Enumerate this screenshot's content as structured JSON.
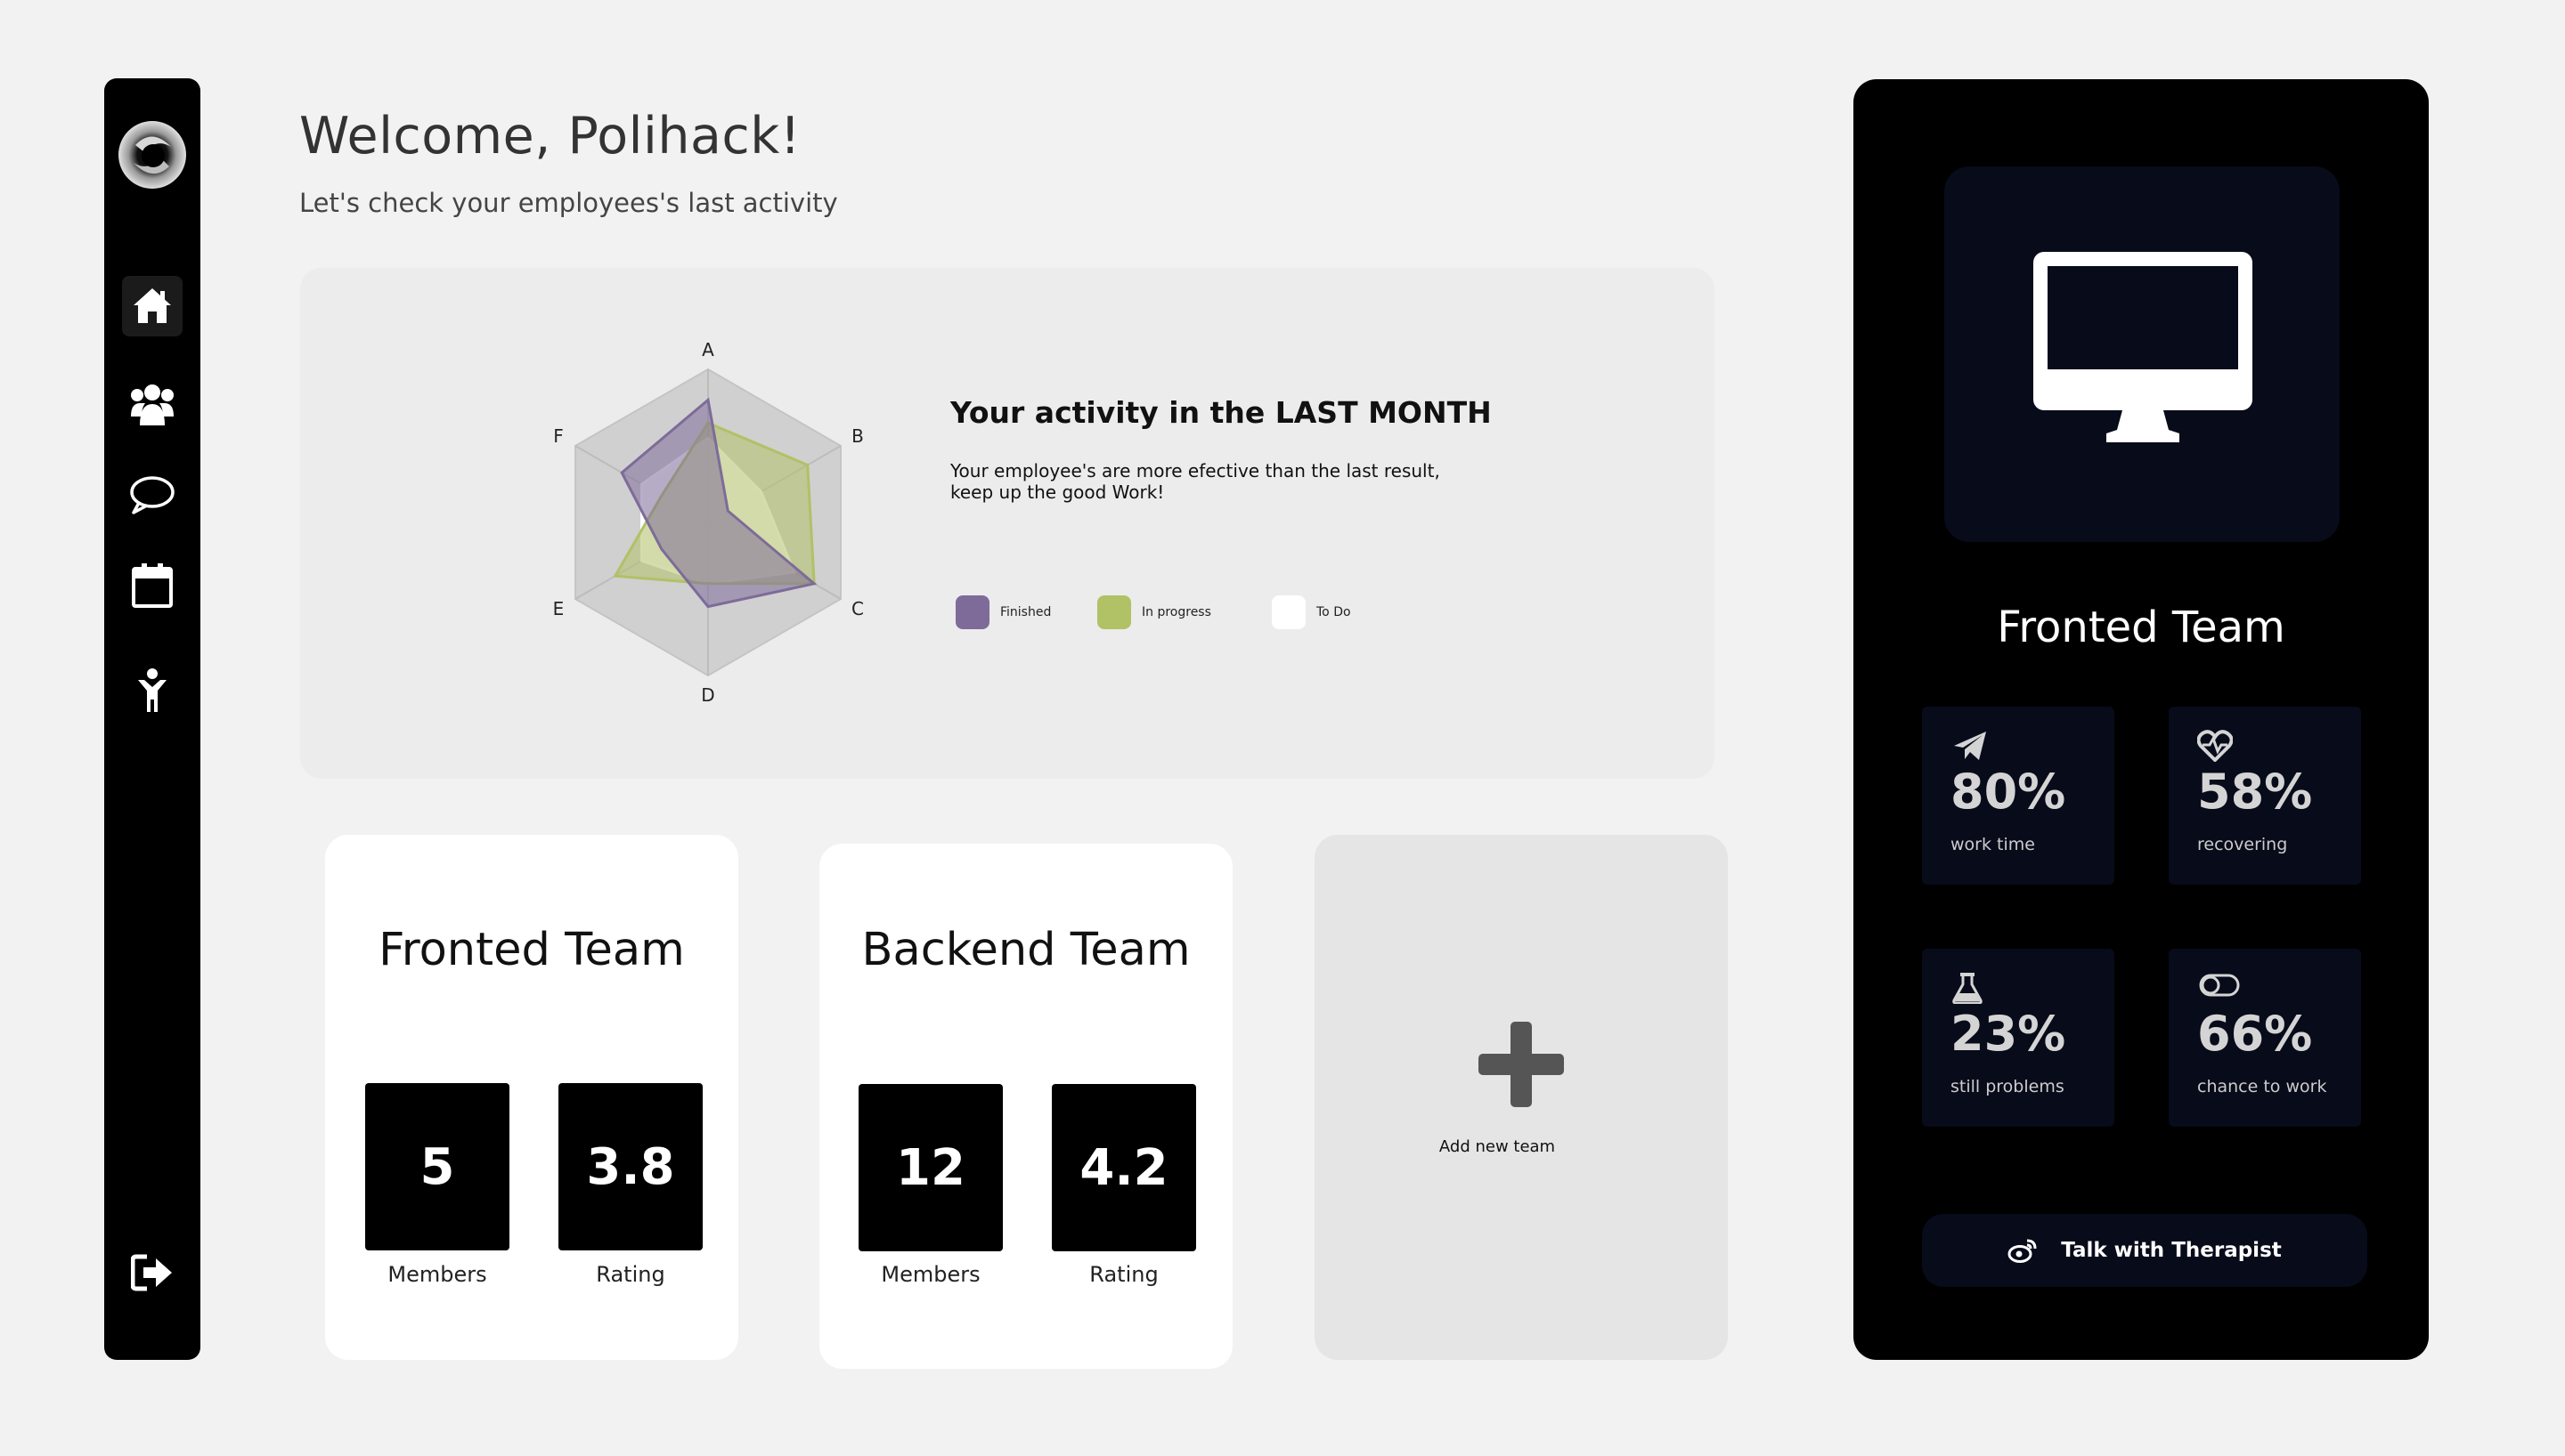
{
  "header": {
    "welcome": "Welcome, Polihack!",
    "subtitle": "Let's check your employees's last activity"
  },
  "sidebar": {
    "items": [
      {
        "icon": "home-icon",
        "active": true
      },
      {
        "icon": "team-icon",
        "active": false
      },
      {
        "icon": "chat-icon",
        "active": false
      },
      {
        "icon": "calendar-icon",
        "active": false
      },
      {
        "icon": "person-icon",
        "active": false
      }
    ],
    "logout_icon": "logout-icon"
  },
  "activity": {
    "title": "Your activity in the LAST MONTH",
    "description": "Your employee's are more efective than the last result, keep up the good Work!",
    "legend": [
      {
        "label": "Finished",
        "color": "#7e6b99"
      },
      {
        "label": "In progress",
        "color": "#b1c166"
      },
      {
        "label": "To Do",
        "color": "#ffffff"
      }
    ]
  },
  "chart_data": {
    "type": "radar",
    "categories": [
      "A",
      "B",
      "C",
      "D",
      "E",
      "F"
    ],
    "rmax": 10,
    "series": [
      {
        "name": "Finished",
        "color": "#7e6b99",
        "values": [
          8,
          1.5,
          8,
          5.5,
          3.5,
          6.5
        ]
      },
      {
        "name": "In progress",
        "color": "#b1c166",
        "values": [
          6.5,
          7.5,
          8,
          4,
          7,
          3.5
        ]
      },
      {
        "name": "To Do",
        "color": "#ffffff",
        "values": [
          5.5,
          4,
          6.5,
          4,
          5,
          5
        ]
      }
    ]
  },
  "teams": [
    {
      "name": "Fronted Team",
      "members": "5",
      "rating": "3.8",
      "members_label": "Members",
      "rating_label": "Rating"
    },
    {
      "name": "Backend Team",
      "members": "12",
      "rating": "4.2",
      "members_label": "Members",
      "rating_label": "Rating"
    }
  ],
  "add_team": {
    "label": "Add new team"
  },
  "panel": {
    "title": "Fronted Team",
    "metrics": [
      {
        "value": "80%",
        "label": "work time",
        "icon": "paper-plane-icon"
      },
      {
        "value": "58%",
        "label": "recovering",
        "icon": "heartbeat-icon"
      },
      {
        "value": "23%",
        "label": "still problems",
        "icon": "flask-icon"
      },
      {
        "value": "66%",
        "label": "chance to work",
        "icon": "toggle-icon"
      }
    ],
    "button_label": "Talk with Therapist",
    "button_icon": "weibo-icon"
  },
  "colors": {
    "background": "#f2f2f2",
    "sidebar": "#000000",
    "panel": "#000000",
    "tile": "#070b1a",
    "finished": "#7e6b99",
    "in_progress": "#b1c166"
  }
}
